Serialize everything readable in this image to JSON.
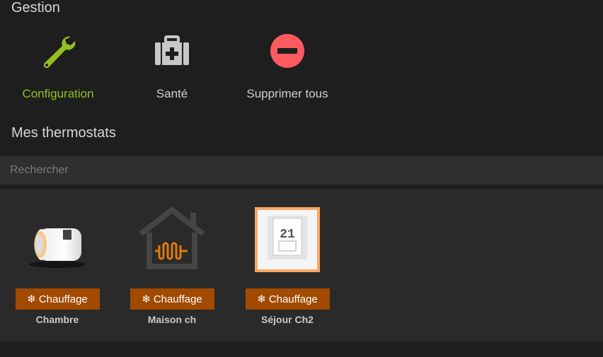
{
  "gestion": {
    "title": "Gestion",
    "actions": [
      {
        "label": "Configuration",
        "icon": "wrench-icon",
        "color": "#94c11f"
      },
      {
        "label": "Santé",
        "icon": "medkit-icon",
        "color": "#c8c8c8"
      },
      {
        "label": "Supprimer tous",
        "icon": "minus-circle-icon",
        "color": "#ff5a5f"
      }
    ]
  },
  "thermostats": {
    "title": "Mes thermostats",
    "search": {
      "placeholder": "Rechercher",
      "value": ""
    },
    "badge_color": "#a14a00",
    "items": [
      {
        "name": "Chambre",
        "mode": "Chauffage",
        "icon": "thermostat-valve-icon"
      },
      {
        "name": "Maison ch",
        "mode": "Chauffage",
        "icon": "house-heating-icon"
      },
      {
        "name": "Séjour Ch2",
        "mode": "Chauffage",
        "icon": "thermostat-display-icon",
        "display": "21"
      }
    ]
  }
}
